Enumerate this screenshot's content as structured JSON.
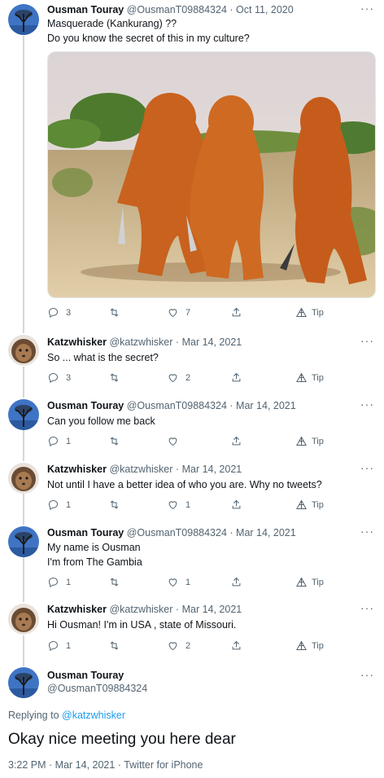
{
  "tweets": [
    {
      "name": "Ousman Touray",
      "handle": "@OusmanT09884324",
      "date": "Oct 11, 2020",
      "lines": [
        "Masquerade (Kankurang) ??",
        "Do you know the secret of this in my culture?"
      ],
      "replies": "3",
      "retweets": "",
      "likes": "7",
      "tip": "Tip"
    },
    {
      "name": "Katzwhisker",
      "handle": "@katzwhisker",
      "date": "Mar 14, 2021",
      "lines": [
        "So ... what is the secret?"
      ],
      "replies": "3",
      "retweets": "",
      "likes": "2",
      "tip": "Tip"
    },
    {
      "name": "Ousman Touray",
      "handle": "@OusmanT09884324",
      "date": "Mar 14, 2021",
      "lines": [
        "Can you follow me back"
      ],
      "replies": "1",
      "retweets": "",
      "likes": "",
      "tip": "Tip"
    },
    {
      "name": "Katzwhisker",
      "handle": "@katzwhisker",
      "date": "Mar 14, 2021",
      "lines": [
        "Not until I have a better idea of who you are.  Why no tweets?"
      ],
      "replies": "1",
      "retweets": "",
      "likes": "1",
      "tip": "Tip"
    },
    {
      "name": "Ousman Touray",
      "handle": "@OusmanT09884324",
      "date": "Mar 14, 2021",
      "lines": [
        "My name is Ousman",
        "I'm from The Gambia"
      ],
      "replies": "1",
      "retweets": "",
      "likes": "1",
      "tip": "Tip"
    },
    {
      "name": "Katzwhisker",
      "handle": "@katzwhisker",
      "date": "Mar 14, 2021",
      "lines": [
        "Hi Ousman!  I'm in USA , state of Missouri."
      ],
      "replies": "1",
      "retweets": "",
      "likes": "2",
      "tip": "Tip"
    }
  ],
  "main_tweet": {
    "name": "Ousman Touray",
    "handle": "@OusmanT09884324",
    "replying_prefix": "Replying to",
    "replying_handle": "@katzwhisker",
    "text": "Okay nice meeting you here dear",
    "timestamp": "3:22 PM · Mar 14, 2021 · Twitter for iPhone"
  },
  "separator": "·",
  "more_glyph": "···",
  "colors": {
    "link": "#1d9bf0",
    "muted": "#536471",
    "thread_line": "#cfd9de"
  },
  "icons": [
    "reply-icon",
    "retweet-icon",
    "like-icon",
    "share-icon",
    "tip-icon",
    "more-icon"
  ]
}
